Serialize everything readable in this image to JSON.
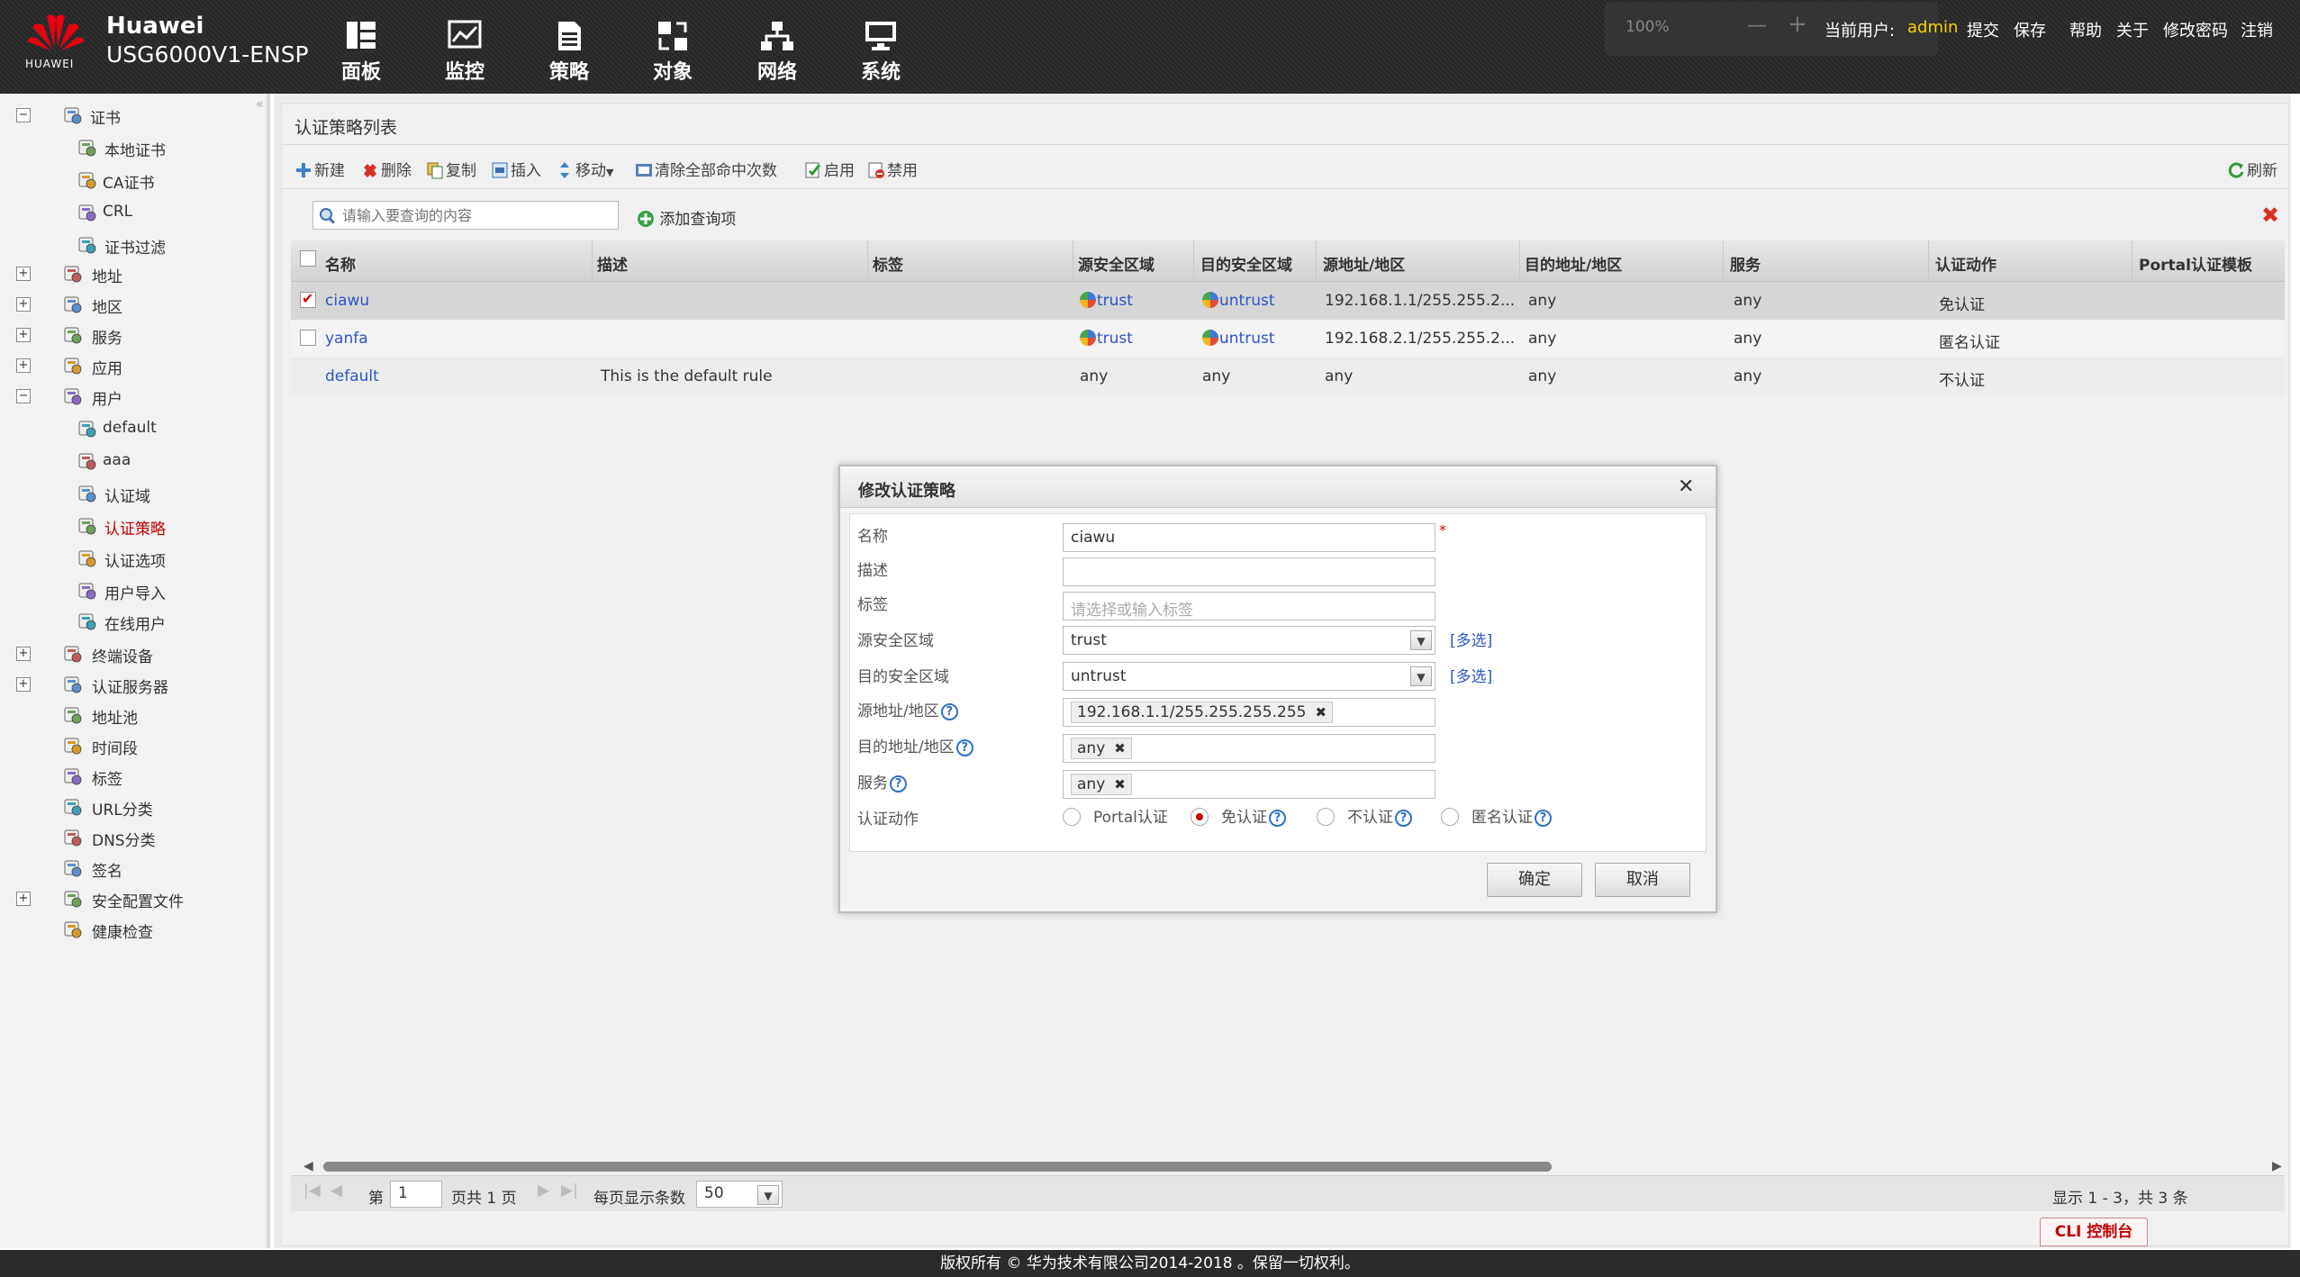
{
  "header": {
    "brand_name": "Huawei",
    "brand_sub": "HUAWEI",
    "device_model": "USG6000V1-ENSP",
    "nav": [
      {
        "label": "面板",
        "icon": "dashboard-icon"
      },
      {
        "label": "监控",
        "icon": "monitor-icon"
      },
      {
        "label": "策略",
        "icon": "policy-icon"
      },
      {
        "label": "对象",
        "icon": "object-icon"
      },
      {
        "label": "网络",
        "icon": "network-icon"
      },
      {
        "label": "系统",
        "icon": "system-icon"
      }
    ],
    "zoom": "100%",
    "current_user_label": "当前用户:",
    "current_user": "admin",
    "links": [
      "提交",
      "保存",
      "帮助",
      "关于",
      "修改密码",
      "注销"
    ],
    "colors": {
      "user": "#f5d400",
      "bg": "#2b2b2b"
    }
  },
  "sidebar": {
    "items": [
      {
        "label": "证书",
        "icon": "certificate-icon"
      },
      {
        "label": "本地证书",
        "icon": "local-cert-icon"
      },
      {
        "label": "CA证书",
        "icon": "ca-cert-icon"
      },
      {
        "label": "CRL",
        "icon": "crl-icon"
      },
      {
        "label": "证书过滤",
        "icon": "cert-filter-icon"
      },
      {
        "label": "地址",
        "icon": "address-icon"
      },
      {
        "label": "地区",
        "icon": "region-icon"
      },
      {
        "label": "服务",
        "icon": "service-icon"
      },
      {
        "label": "应用",
        "icon": "application-icon"
      },
      {
        "label": "用户",
        "icon": "user-icon"
      },
      {
        "label": "default",
        "icon": "user-group-icon"
      },
      {
        "label": "aaa",
        "icon": "user-group-icon"
      },
      {
        "label": "认证域",
        "icon": "auth-domain-icon"
      },
      {
        "label": "认证策略",
        "icon": "auth-policy-icon"
      },
      {
        "label": "认证选项",
        "icon": "auth-option-icon"
      },
      {
        "label": "用户导入",
        "icon": "user-import-icon"
      },
      {
        "label": "在线用户",
        "icon": "online-user-icon"
      },
      {
        "label": "终端设备",
        "icon": "terminal-device-icon"
      },
      {
        "label": "认证服务器",
        "icon": "auth-server-icon"
      },
      {
        "label": "地址池",
        "icon": "address-pool-icon"
      },
      {
        "label": "时间段",
        "icon": "time-range-icon"
      },
      {
        "label": "标签",
        "icon": "tag-icon"
      },
      {
        "label": "URL分类",
        "icon": "url-category-icon"
      },
      {
        "label": "DNS分类",
        "icon": "dns-category-icon"
      },
      {
        "label": "签名",
        "icon": "signature-icon"
      },
      {
        "label": "安全配置文件",
        "icon": "security-profile-icon"
      },
      {
        "label": "健康检查",
        "icon": "health-check-icon"
      }
    ],
    "selected": "认证策略"
  },
  "main": {
    "title": "认证策略列表",
    "toolbar": {
      "new": "新建",
      "delete": "删除",
      "copy": "复制",
      "insert": "插入",
      "move": "移动",
      "clear_hits": "清除全部命中次数",
      "enable": "启用",
      "disable": "禁用",
      "refresh": "刷新"
    },
    "search": {
      "placeholder": "请输入要查询的内容",
      "add_filter": "添加查询项"
    },
    "columns": [
      "名称",
      "描述",
      "标签",
      "源安全区域",
      "目的安全区域",
      "源地址/地区",
      "目的地址/地区",
      "服务",
      "认证动作",
      "Portal认证模板"
    ],
    "rows": [
      {
        "checked": true,
        "name": "ciawu",
        "desc": "",
        "tag": "",
        "src_zone": "trust",
        "dst_zone": "untrust",
        "src_addr": "192.168.1.1/255.255.2...",
        "dst_addr": "any",
        "service": "any",
        "action": "免认证",
        "portal": ""
      },
      {
        "checked": false,
        "name": "yanfa",
        "desc": "",
        "tag": "",
        "src_zone": "trust",
        "dst_zone": "untrust",
        "src_addr": "192.168.2.1/255.255.2...",
        "dst_addr": "any",
        "service": "any",
        "action": "匿名认证",
        "portal": ""
      },
      {
        "checked": null,
        "name": "default",
        "desc": "This is the default rule",
        "tag": "",
        "src_zone": "any",
        "dst_zone": "any",
        "src_addr": "any",
        "dst_addr": "any",
        "service": "any",
        "action": "不认证",
        "portal": ""
      }
    ],
    "pager": {
      "page_prefix": "第",
      "page": "1",
      "page_suffix": "页共 1 页",
      "per_page_label": "每页显示条数",
      "per_page": "50",
      "summary": "显示 1 - 3，共 3 条"
    }
  },
  "dialog": {
    "title": "修改认证策略",
    "fields": {
      "name_label": "名称",
      "name_value": "ciawu",
      "required": "*",
      "desc_label": "描述",
      "desc_value": "",
      "tag_label": "标签",
      "tag_placeholder": "请选择或输入标签",
      "src_zone_label": "源安全区域",
      "src_zone_value": "trust",
      "dst_zone_label": "目的安全区域",
      "dst_zone_value": "untrust",
      "multi": "[多选]",
      "src_addr_label": "源地址/地区",
      "src_addr_tag": "192.168.1.1/255.255.255.255",
      "dst_addr_label": "目的地址/地区",
      "dst_addr_tag": "any",
      "service_label": "服务",
      "service_tag": "any",
      "action_label": "认证动作",
      "actions": [
        "Portal认证",
        "免认证",
        "不认证",
        "匿名认证"
      ],
      "action_selected": "免认证"
    },
    "ok": "确定",
    "cancel": "取消"
  },
  "cli_label": "CLI 控制台",
  "footer": "版权所有 © 华为技术有限公司2014-2018 。保留一切权利。"
}
